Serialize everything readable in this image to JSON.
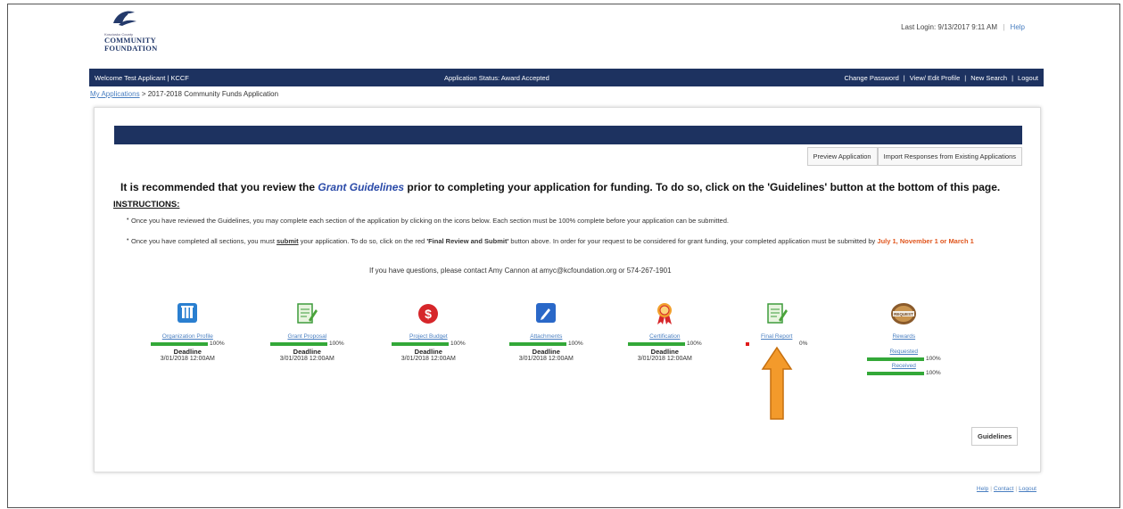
{
  "logo": {
    "tagline": "Kosciusko County",
    "name_line1": "COMMUNITY",
    "name_line2": "FOUNDATION"
  },
  "top": {
    "last_login": "Last Login: 9/13/2017 9:11 AM",
    "help": "Help"
  },
  "navbar": {
    "welcome": "Welcome Test Applicant | KCCF",
    "status": "Application Status: Award Accepted",
    "links": [
      "Change Password",
      "View/ Edit Profile",
      "New Search",
      "Logout"
    ]
  },
  "breadcrumb": {
    "link": "My Applications",
    "sep": ">",
    "current": "2017-2018 Community Funds Application"
  },
  "buttons": {
    "preview": "Preview Application",
    "import": "Import Responses from Existing Applications",
    "guidelines": "Guidelines"
  },
  "recommend": {
    "pre": "It is recommended that you review the ",
    "link": "Grant Guidelines",
    "post": " prior to completing your application for funding.  To do so, click on the 'Guidelines' button at the bottom of this page."
  },
  "instructions": {
    "heading": "INSTRUCTIONS:",
    "item1": "Once you have reviewed the Guidelines, you may complete each section of the application by clicking on the icons below.  Each section must be 100% complete before your application can be submitted.",
    "item2_a": "Once you have completed all sections, you must ",
    "item2_b": "submit",
    "item2_c": " your application.  To do so, click on the red ",
    "item2_d": "'Final Review and Submit'",
    "item2_e": " button above.  In order for your request to be considered for grant funding, your completed application must be submitted by ",
    "item2_f": "July 1, November 1 or March 1"
  },
  "contact": "If you have questions, please contact Amy Cannon at amyc@kcfoundation.org or 574-267-1901",
  "sections": [
    {
      "label": "Organization Profile",
      "progress": 100,
      "pct": "100%",
      "deadline_label": "Deadline",
      "deadline": "3/01/2018 12:00AM"
    },
    {
      "label": "Grant Proposal",
      "progress": 100,
      "pct": "100%",
      "deadline_label": "Deadline",
      "deadline": "3/01/2018 12:00AM"
    },
    {
      "label": "Project Budget",
      "progress": 100,
      "pct": "100%",
      "deadline_label": "Deadline",
      "deadline": "3/01/2018 12:00AM"
    },
    {
      "label": "Attachments",
      "progress": 100,
      "pct": "100%",
      "deadline_label": "Deadline",
      "deadline": "3/01/2018 12:00AM"
    },
    {
      "label": "Certification",
      "progress": 100,
      "pct": "100%",
      "deadline_label": "Deadline",
      "deadline": "3/01/2018 12:00AM"
    },
    {
      "label": "Final Report",
      "progress": 0,
      "pct": "0%"
    }
  ],
  "reward": {
    "label": "Rewards",
    "badge": "REQUEST",
    "requested": "Requested",
    "requested_pct": "100%",
    "received": "Received",
    "received_pct": "100%"
  },
  "footer": {
    "help": "Help",
    "contact": "Contact",
    "logout": "Logout"
  },
  "colors": {
    "navy": "#1d3260",
    "progress": "#33a838",
    "link": "#4a7fc1",
    "arrow": "#f39a2b",
    "deadline_highlight": "#e0561e"
  }
}
